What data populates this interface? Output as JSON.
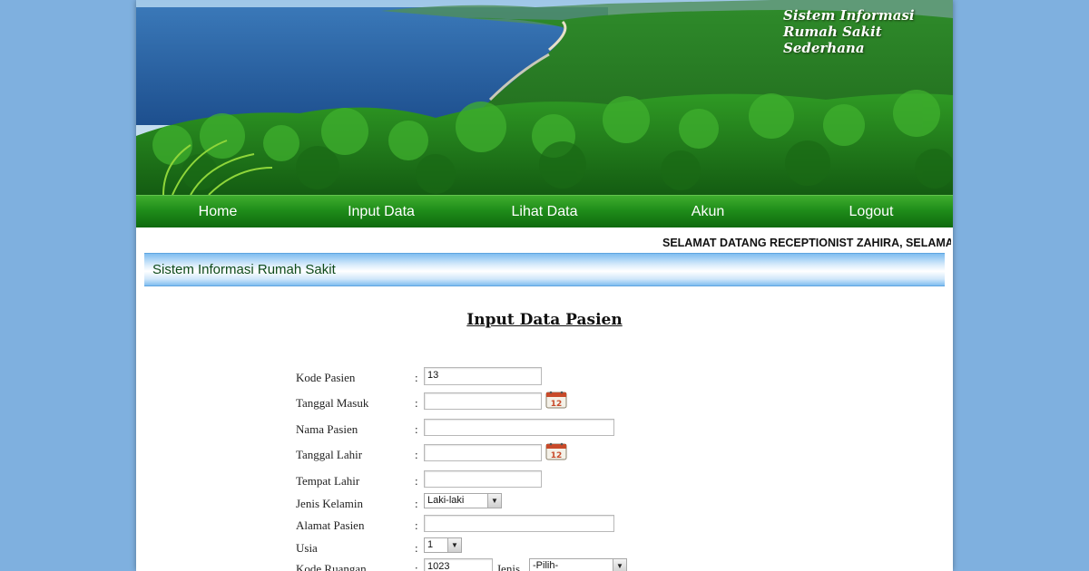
{
  "banner": {
    "title_lines": [
      "Sistem Informasi",
      "Rumah Sakit",
      "Sederhana"
    ]
  },
  "nav": {
    "items": [
      "Home",
      "Input Data",
      "Lihat Data",
      "Akun",
      "Logout"
    ]
  },
  "welcome_text": "SELAMAT DATANG RECEPTIONIST ZAHIRA, SELAMAT",
  "section_title": "Sistem Informasi Rumah Sakit",
  "form": {
    "title": "Input Data Pasien",
    "colon": ":",
    "fields": {
      "kode_pasien": {
        "label": "Kode Pasien",
        "value": "13"
      },
      "tanggal_masuk": {
        "label": "Tanggal Masuk",
        "value": "",
        "calendar_icon": "calendar-12-icon"
      },
      "nama_pasien": {
        "label": "Nama Pasien",
        "value": ""
      },
      "tanggal_lahir": {
        "label": "Tanggal Lahir",
        "value": "",
        "calendar_icon": "calendar-12-icon"
      },
      "tempat_lahir": {
        "label": "Tempat Lahir",
        "value": ""
      },
      "jenis_kelamin": {
        "label": "Jenis Kelamin",
        "selected": "Laki-laki"
      },
      "alamat_pasien": {
        "label": "Alamat Pasien",
        "value": ""
      },
      "usia": {
        "label": "Usia",
        "selected": "1"
      },
      "kode_ruangan": {
        "label": "Kode Ruangan",
        "value": "1023",
        "jenis_label": "Jenis :",
        "jenis_selected": "-Pilih-"
      }
    },
    "calendar_day": "12"
  },
  "colors": {
    "page_background": "#7fb0df",
    "nav_green": "#1f8d1a",
    "section_blue": "#7fbdf0"
  }
}
